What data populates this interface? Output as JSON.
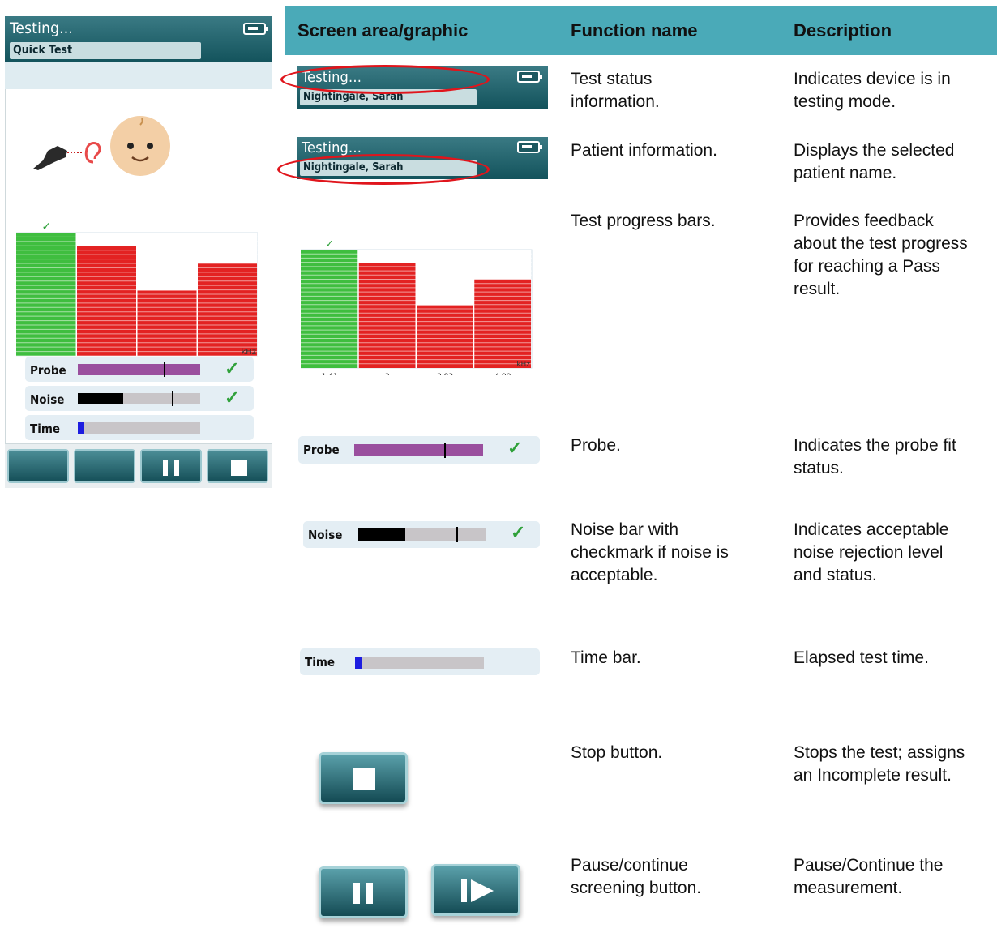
{
  "device": {
    "title": "Testing...",
    "mode_label": "Quick Test",
    "icons": [
      "battery-icon",
      "probe-icon",
      "ear-icon",
      "baby-face-icon",
      "pause-icon",
      "stop-icon"
    ],
    "meters": {
      "probe": {
        "label": "Probe",
        "fill_fraction": 1.0,
        "marker_fraction": 0.7,
        "ok": true,
        "color": "#9a4f9e"
      },
      "noise": {
        "label": "Noise",
        "fill_fraction": 0.37,
        "marker_fraction": 0.77,
        "ok": true,
        "color": "#000000"
      },
      "time": {
        "label": "Time",
        "fill_fraction": 0.05,
        "color": "#1d1de0"
      }
    },
    "check_glyph": "✓"
  },
  "chart_data": {
    "type": "bar",
    "categories": [
      "1.41",
      "2",
      "2.83",
      "4.00"
    ],
    "values": [
      100,
      89,
      53,
      75
    ],
    "ylim": [
      0,
      100
    ],
    "colors": [
      "#3fbe3f",
      "#e32222",
      "#e32222",
      "#e32222"
    ],
    "passed": [
      true,
      false,
      false,
      false
    ],
    "unit_label": "kHz",
    "grid": true
  },
  "table": {
    "headers": [
      "Screen area/graphic",
      "Function name",
      "Description"
    ],
    "sample_header": {
      "title": "Testing...",
      "patient_name": "Nightingale, Sarah"
    },
    "rows": [
      {
        "function": "Test status\ninformation.",
        "description": "Indicates device is in\ntesting mode."
      },
      {
        "function": "Patient information.",
        "description": "Displays the selected\npatient name."
      },
      {
        "function": "Test progress bars.",
        "description": "Provides feedback\nabout the test progress\nfor reaching a Pass\nresult."
      },
      {
        "function": "Probe.",
        "description": "Indicates the probe fit\nstatus."
      },
      {
        "function": "Noise bar with\ncheckmark if noise is\nacceptable.",
        "description": "Indicates acceptable\nnoise rejection level\nand status."
      },
      {
        "function": "Time bar.",
        "description": "Elapsed test time."
      },
      {
        "function": "Stop button.",
        "description": "Stops the test; assigns\nan Incomplete result."
      },
      {
        "function": "Pause/continue\nscreening button.",
        "description": "Pause/Continue the\nmeasurement."
      }
    ],
    "highlight_color": "#e0151c"
  }
}
